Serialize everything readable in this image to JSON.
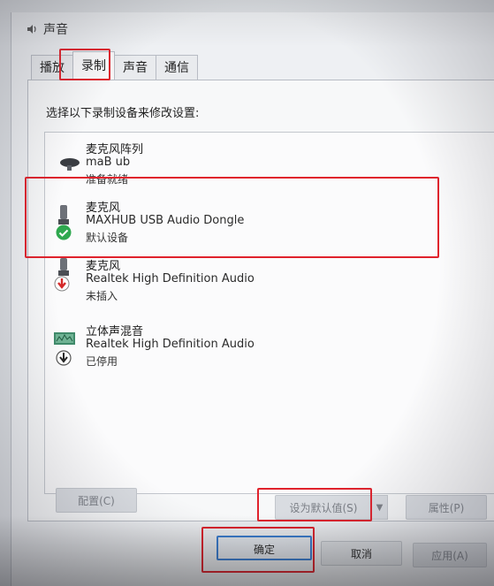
{
  "window": {
    "title": "声音"
  },
  "tabs": [
    {
      "label": "播放"
    },
    {
      "label": "录制"
    },
    {
      "label": "声音"
    },
    {
      "label": "通信"
    }
  ],
  "instruction": "选择以下录制设备来修改设置:",
  "devices": [
    {
      "name": "麦克风阵列",
      "description": "maB ub",
      "status": "准备就绪",
      "status_icon": "none",
      "device_icon": "mic-array-icon"
    },
    {
      "name": "麦克风",
      "description": "MAXHUB USB Audio Dongle",
      "status": "默认设备",
      "status_icon": "green-check-icon",
      "device_icon": "microphone-icon"
    },
    {
      "name": "麦克风",
      "description": "Realtek High Definition Audio",
      "status": "未插入",
      "status_icon": "red-down-arrow-icon",
      "device_icon": "microphone-icon"
    },
    {
      "name": "立体声混音",
      "description": "Realtek High Definition Audio",
      "status": "已停用",
      "status_icon": "down-arrow-icon",
      "device_icon": "stereo-mix-icon"
    }
  ],
  "buttons": {
    "configure": "配置(C)",
    "set_default": "设为默认值(S)",
    "properties": "属性(P)",
    "ok": "确定",
    "cancel": "取消",
    "apply": "应用(A)"
  },
  "colors": {
    "highlight_red": "#e0222c",
    "level_meter_blue": "#4d8fd6",
    "default_check_green": "#2fa84f"
  }
}
